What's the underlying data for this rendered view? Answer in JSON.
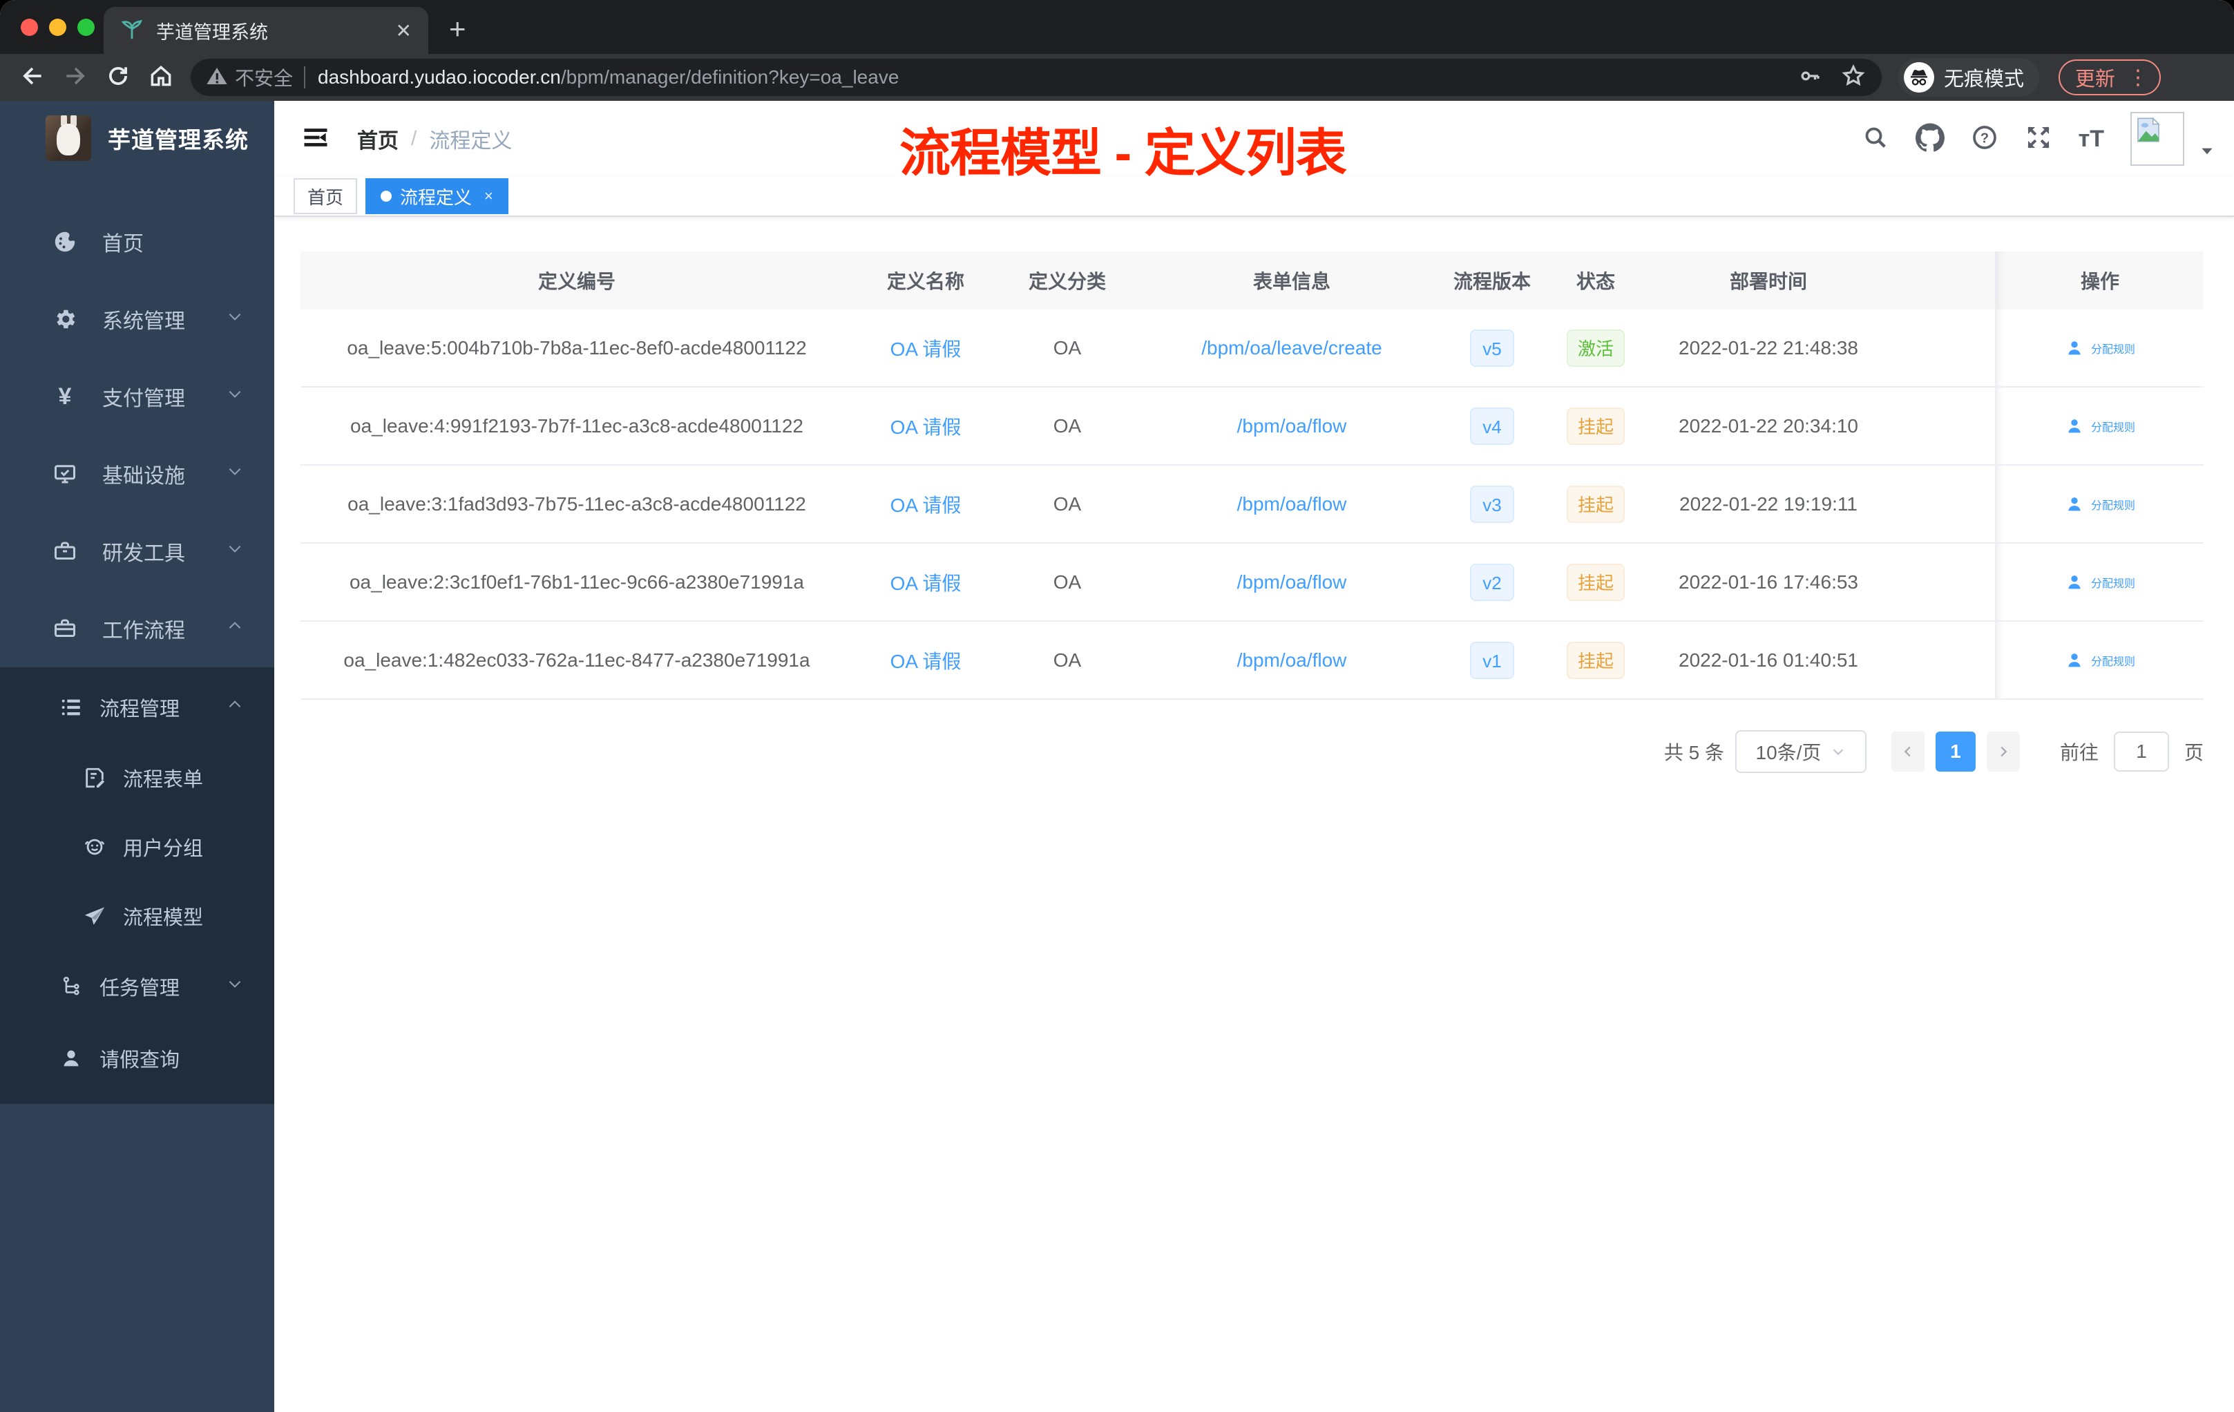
{
  "browser": {
    "tab_title": "芋道管理系统",
    "not_secure": "不安全",
    "url_host": "dashboard.yudao.iocoder.cn",
    "url_path": "/bpm/manager/definition?key=oa_leave",
    "incognito_label": "无痕模式",
    "update_label": "更新"
  },
  "sidebar": {
    "logo_title": "芋道管理系统",
    "items": [
      {
        "label": "首页"
      },
      {
        "label": "系统管理"
      },
      {
        "label": "支付管理"
      },
      {
        "label": "基础设施"
      },
      {
        "label": "研发工具"
      },
      {
        "label": "工作流程"
      },
      {
        "label": "流程管理"
      },
      {
        "label": "流程表单"
      },
      {
        "label": "用户分组"
      },
      {
        "label": "流程模型"
      },
      {
        "label": "任务管理"
      },
      {
        "label": "请假查询"
      }
    ]
  },
  "header": {
    "breadcrumb_home": "首页",
    "breadcrumb_sep": "/",
    "breadcrumb_current": "流程定义",
    "overlay_title": "流程模型 - 定义列表"
  },
  "tags": {
    "home": "首页",
    "active": "流程定义",
    "close": "×"
  },
  "table": {
    "columns": {
      "id": "定义编号",
      "name": "定义名称",
      "category": "定义分类",
      "form": "表单信息",
      "version": "流程版本",
      "status": "状态",
      "deploy_time": "部署时间",
      "action": "操作"
    },
    "rows": [
      {
        "id": "oa_leave:5:004b710b-7b8a-11ec-8ef0-acde48001122",
        "name": "OA 请假",
        "category": "OA",
        "form": "/bpm/oa/leave/create",
        "version": "v5",
        "status": "激活",
        "status_type": "success",
        "deploy_time": "2022-01-22 21:48:38",
        "action": "分配规则"
      },
      {
        "id": "oa_leave:4:991f2193-7b7f-11ec-a3c8-acde48001122",
        "name": "OA 请假",
        "category": "OA",
        "form": "/bpm/oa/flow",
        "version": "v4",
        "status": "挂起",
        "status_type": "warning",
        "deploy_time": "2022-01-22 20:34:10",
        "action": "分配规则"
      },
      {
        "id": "oa_leave:3:1fad3d93-7b75-11ec-a3c8-acde48001122",
        "name": "OA 请假",
        "category": "OA",
        "form": "/bpm/oa/flow",
        "version": "v3",
        "status": "挂起",
        "status_type": "warning",
        "deploy_time": "2022-01-22 19:19:11",
        "action": "分配规则"
      },
      {
        "id": "oa_leave:2:3c1f0ef1-76b1-11ec-9c66-a2380e71991a",
        "name": "OA 请假",
        "category": "OA",
        "form": "/bpm/oa/flow",
        "version": "v2",
        "status": "挂起",
        "status_type": "warning",
        "deploy_time": "2022-01-16 17:46:53",
        "action": "分配规则"
      },
      {
        "id": "oa_leave:1:482ec033-762a-11ec-8477-a2380e71991a",
        "name": "OA 请假",
        "category": "OA",
        "form": "/bpm/oa/flow",
        "version": "v1",
        "status": "挂起",
        "status_type": "warning",
        "deploy_time": "2022-01-16 01:40:51",
        "action": "分配规则"
      }
    ]
  },
  "pagination": {
    "total": "共 5 条",
    "page_size": "10条/页",
    "current_page": "1",
    "goto_label": "前往",
    "goto_value": "1",
    "page_unit": "页"
  },
  "colors": {
    "primary": "#409eff",
    "active_tag": "#2d8cf0",
    "success": "#5cc03a",
    "warning": "#e6a23c",
    "annotation_red": "#ff2600",
    "sidebar_bg": "#304156",
    "submenu_bg": "#1f2d3d"
  }
}
